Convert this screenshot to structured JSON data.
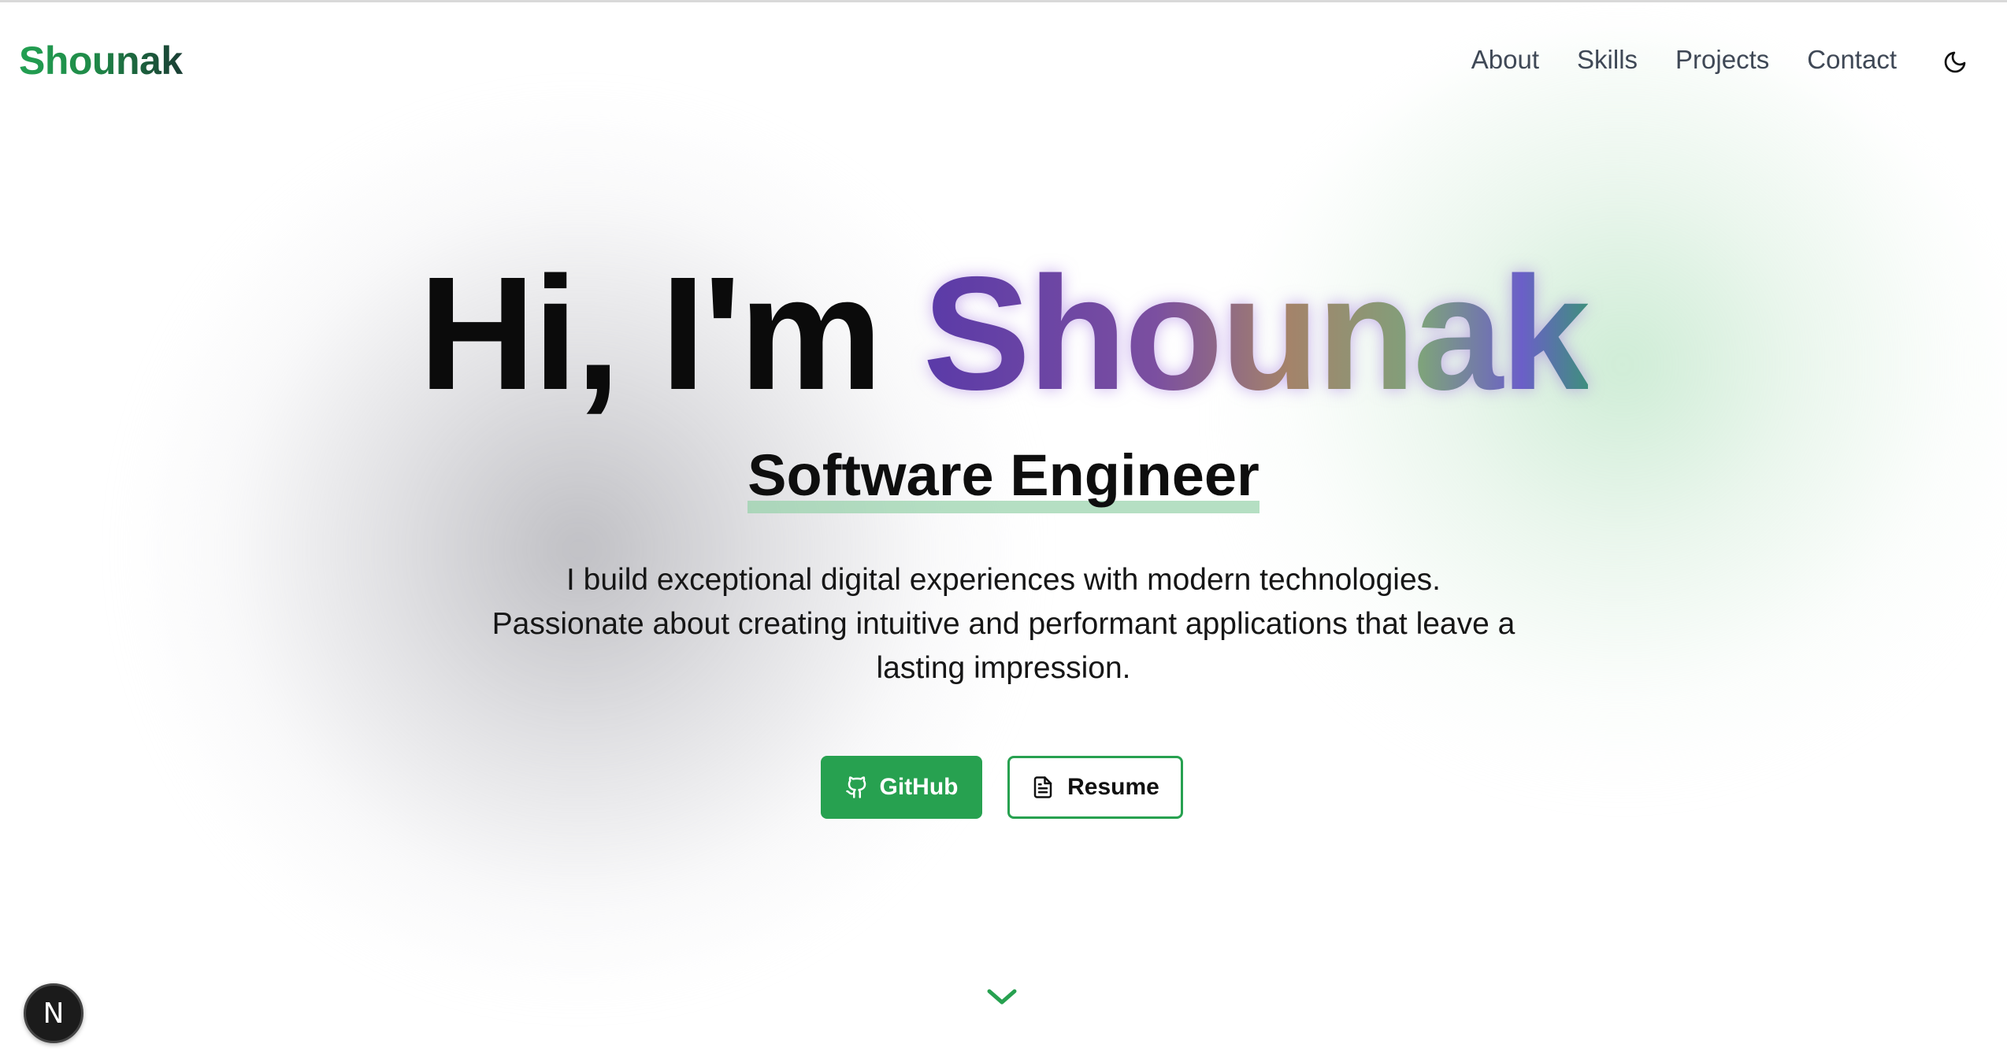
{
  "nav": {
    "logo": "Shounak",
    "links": [
      "About",
      "Skills",
      "Projects",
      "Contact"
    ],
    "theme_toggle_icon": "moon-icon"
  },
  "hero": {
    "greeting": "Hi, I'm",
    "name": "Shounak",
    "subtitle": "Software Engineer",
    "description": "I build exceptional digital experiences with modern technologies. Passionate about creating intuitive and performant applications that leave a lasting impression.",
    "buttons": {
      "github": {
        "label": "GitHub",
        "icon": "github-icon"
      },
      "resume": {
        "label": "Resume",
        "icon": "document-icon"
      }
    }
  },
  "scroll_icon": "chevron-down-icon",
  "dev_badge": {
    "label": "N",
    "icon": "nextjs-icon"
  },
  "colors": {
    "accent": "#27a150",
    "nav_text": "#3f4856",
    "text": "#0b0b0b"
  }
}
